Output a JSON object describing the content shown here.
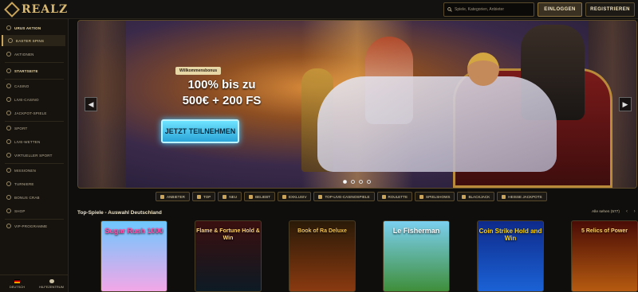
{
  "header": {
    "logo_text": "REALZ",
    "search_placeholder": "Spiele, Kategorien, Anbieter",
    "login_label": "EINLOGGEN",
    "register_label": "REGISTRIEREN"
  },
  "sidebar": {
    "items": [
      {
        "label": "URUS AKTION"
      },
      {
        "label": "EASTER SPINS"
      },
      {
        "label": "AKTIONEN"
      },
      {
        "label": "STARTSEITE"
      },
      {
        "label": "CASINO"
      },
      {
        "label": "LIVE-CASINO"
      },
      {
        "label": "JACKPOT-SPIELE"
      },
      {
        "label": "SPORT"
      },
      {
        "label": "LIVE-WETTEN"
      },
      {
        "label": "VIRTUELLER SPORT"
      },
      {
        "label": "MISSIONEN"
      },
      {
        "label": "TURNIERE"
      },
      {
        "label": "BONUS CRAB"
      },
      {
        "label": "SHOP"
      },
      {
        "label": "VIP-PROGRAMME"
      }
    ],
    "language_label": "DEUTSCH",
    "help_label": "HILFEZENTRUM"
  },
  "hero": {
    "badge": "Willkommensbonus",
    "title_line1": "100% bis zu",
    "title_line2": "500€ + 200 FS",
    "cta": "JETZT TEILNEHMEN",
    "prev_icon": "◀",
    "next_icon": "▶"
  },
  "categories": [
    {
      "label": "ANBIETER"
    },
    {
      "label": "TOP"
    },
    {
      "label": "NEU"
    },
    {
      "label": "BELIEBT"
    },
    {
      "label": "EXKLUSIV"
    },
    {
      "label": "TOP-LIVE-CASINOSPIELE"
    },
    {
      "label": "ROULETTE"
    },
    {
      "label": "SPIELSHOWS"
    },
    {
      "label": "BLACKJACK"
    },
    {
      "label": "HEISSE JACKPOTS"
    }
  ],
  "games_section": {
    "title": "Top-Spiele - Auswahl Deutschland",
    "see_all": "Alle sehen (577)",
    "pager": "‹ ›",
    "games": [
      {
        "title": "Sugar Rush 1000",
        "bg_top": "#6ec7ff",
        "bg_bottom": "#f3a7e7",
        "text_color": "#ff4fa8"
      },
      {
        "title": "Flame & Fortune Hold & Win",
        "bg_top": "#3a0f0f",
        "bg_bottom": "#0d1a24",
        "text_color": "#ffd36b"
      },
      {
        "title": "Book of Ra Deluxe",
        "bg_top": "#2a1a08",
        "bg_bottom": "#8a3a10",
        "text_color": "#f2c14e"
      },
      {
        "title": "Le Fisherman",
        "bg_top": "#7bd0f0",
        "bg_bottom": "#3f8e3a",
        "text_color": "#ffffff"
      },
      {
        "title": "Coin Strike Hold and Win",
        "bg_top": "#0e2a8a",
        "bg_bottom": "#1b62d6",
        "text_color": "#ffd200"
      },
      {
        "title": "5 Relics of Power",
        "bg_top": "#4a0c06",
        "bg_bottom": "#b55a10",
        "text_color": "#ffd36b"
      }
    ]
  },
  "colors": {
    "accent": "#c9a45a",
    "background": "#0f0e0c",
    "cta": "#2aa4d8"
  }
}
